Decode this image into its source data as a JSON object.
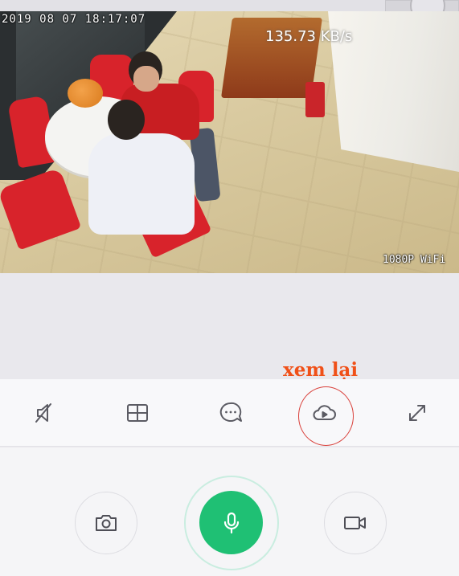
{
  "camera": {
    "timestamp": "2019 08 07 18:17:07",
    "bitrate": "135.73 KB/s",
    "resolution_label": "1080P WiFi"
  },
  "annotation": {
    "text": "xem lại",
    "color": "#f05018"
  },
  "toolbar": {
    "buttons": [
      {
        "icon": "mute-icon"
      },
      {
        "icon": "split-view-icon"
      },
      {
        "icon": "chat-bubble-icon"
      },
      {
        "icon": "cloud-playback-icon"
      },
      {
        "icon": "fullscreen-icon"
      }
    ]
  },
  "controls": {
    "snapshot_icon": "camera-icon",
    "talk_icon": "microphone-icon",
    "record_icon": "video-camera-icon",
    "accent": "#1fc074"
  }
}
